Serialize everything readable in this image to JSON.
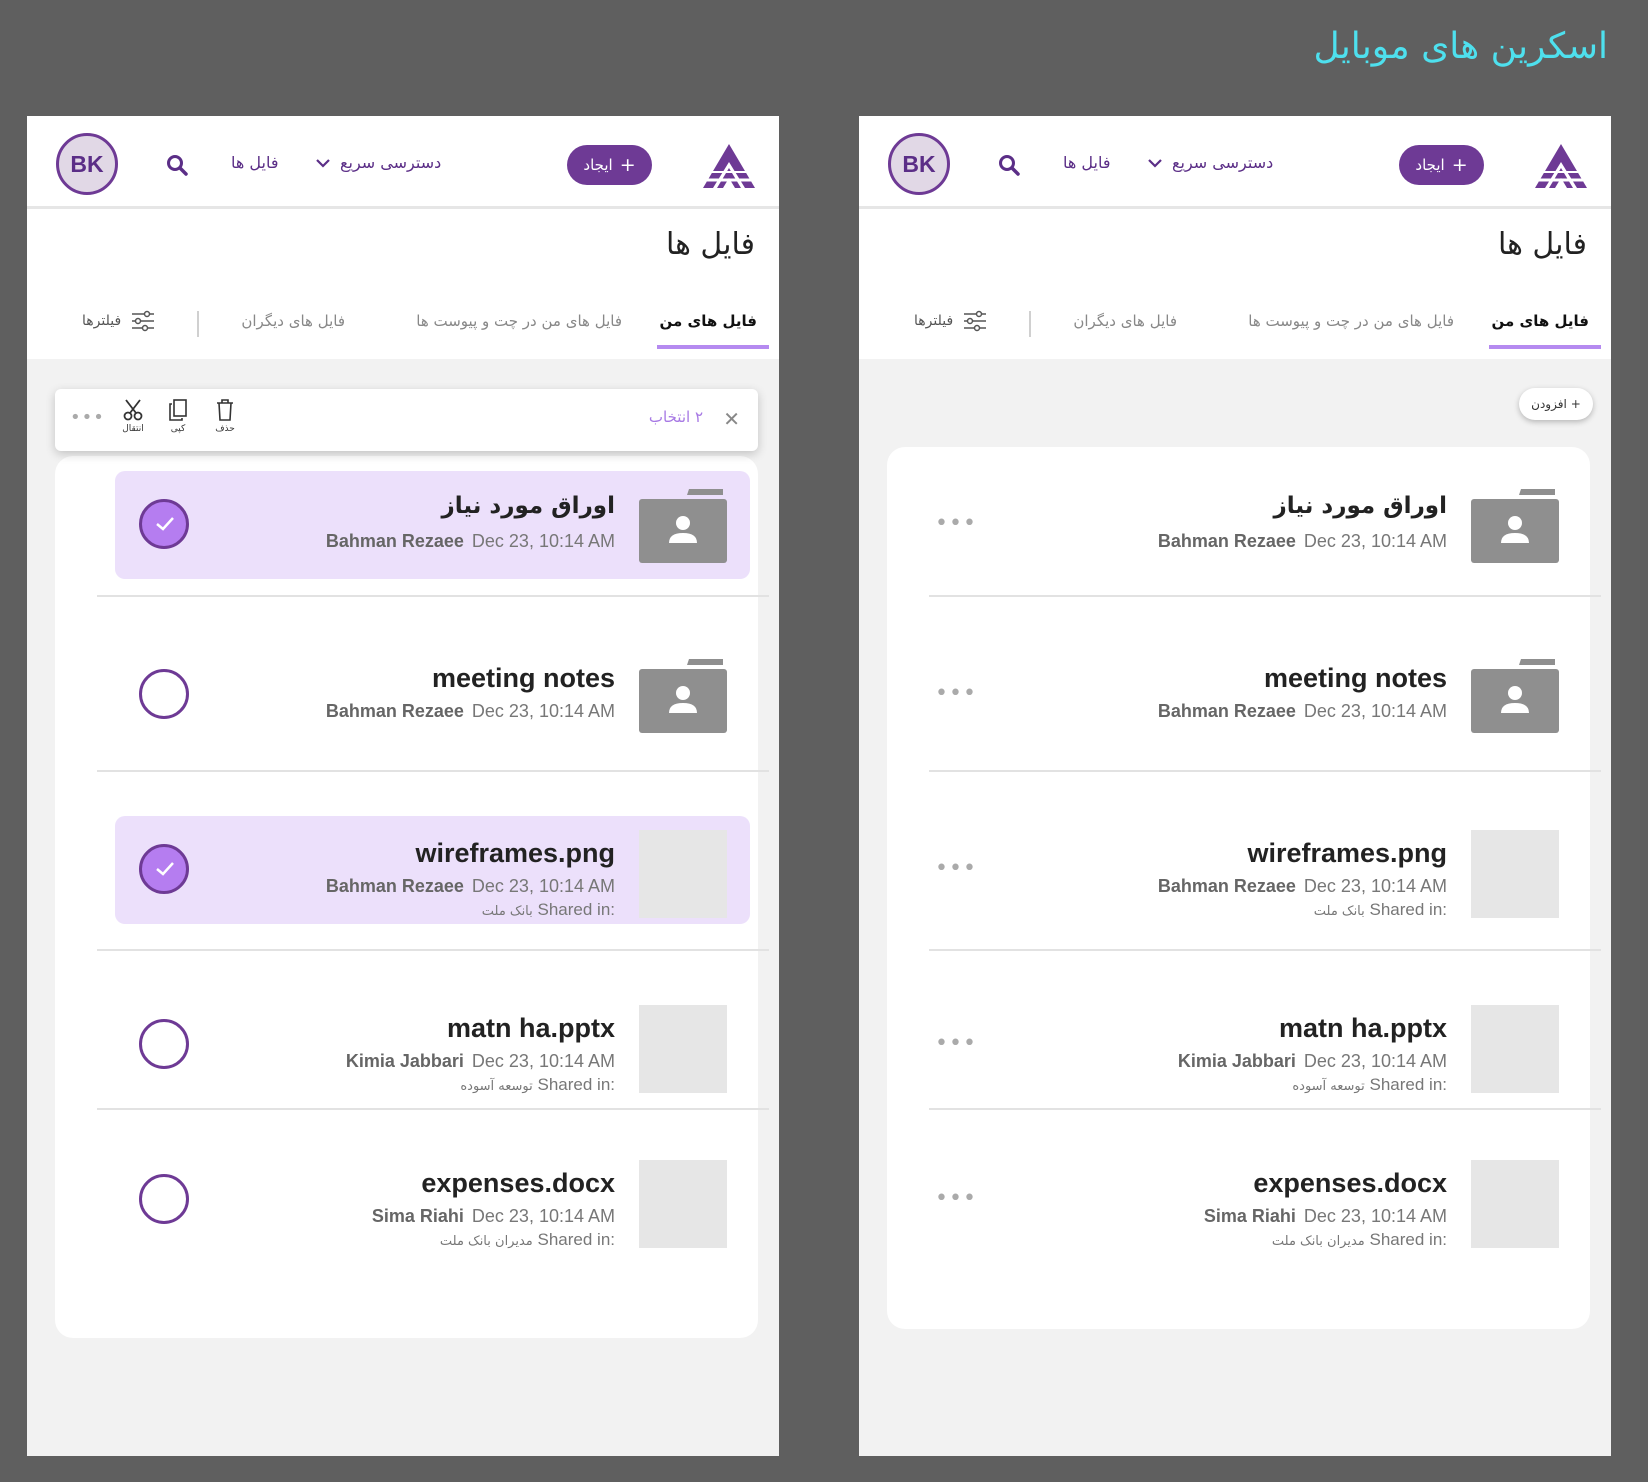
{
  "page_title": "اسکرین های موبایل",
  "app": {
    "avatar_initials": "BK",
    "create_label": "ایجاد",
    "quick_access_label": "دسترسی سریع",
    "files_nav_label": "فایل ها",
    "page_heading": "فایل ها",
    "tabs": {
      "mine": "فایل های من",
      "chat": "فایل های من در چت و پیوست ها",
      "others": "فایل های دیگران"
    },
    "filters_label": "فیلترها",
    "add_label": "افزودن",
    "selection": {
      "count_label": "۲ انتخاب",
      "delete_label": "حذف",
      "copy_label": "کپی",
      "move_label": "انتقال"
    }
  },
  "shared_prefix": "Shared in:",
  "files": [
    {
      "name": "اوراق مورد نیاز",
      "owner": "Bahman Rezaee",
      "date": "Dec 23, 10:14 AM",
      "shared_in": "",
      "type": "folder",
      "selected": true
    },
    {
      "name": "meeting notes",
      "owner": "Bahman Rezaee",
      "date": "Dec 23, 10:14 AM",
      "shared_in": "",
      "type": "folder",
      "selected": false
    },
    {
      "name": "wireframes.png",
      "owner": "Bahman Rezaee",
      "date": "Dec 23, 10:14 AM",
      "shared_in": "بانک ملت",
      "type": "file",
      "selected": true
    },
    {
      "name": "matn ha.pptx",
      "owner": "Kimia Jabbari",
      "date": "Dec 23, 10:14 AM",
      "shared_in": "توسعه آسوده",
      "type": "file",
      "selected": false
    },
    {
      "name": "expenses.docx",
      "owner": "Sima Riahi",
      "date": "Dec 23, 10:14 AM",
      "shared_in": "مدیران بانک ملت",
      "type": "file",
      "selected": false
    }
  ],
  "colors": {
    "brand": "#6e3a95",
    "accent": "#b58af0",
    "selected_bg": "#ece0fb",
    "title_accent": "#4ee0ee",
    "background": "#5f5f5f"
  },
  "icons": [
    "logo-icon",
    "plus-icon",
    "chevron-down-icon",
    "search-icon",
    "filter-icon",
    "close-icon",
    "trash-icon",
    "copy-icon",
    "scissors-icon",
    "more-icon",
    "folder-shared-icon",
    "check-icon"
  ]
}
